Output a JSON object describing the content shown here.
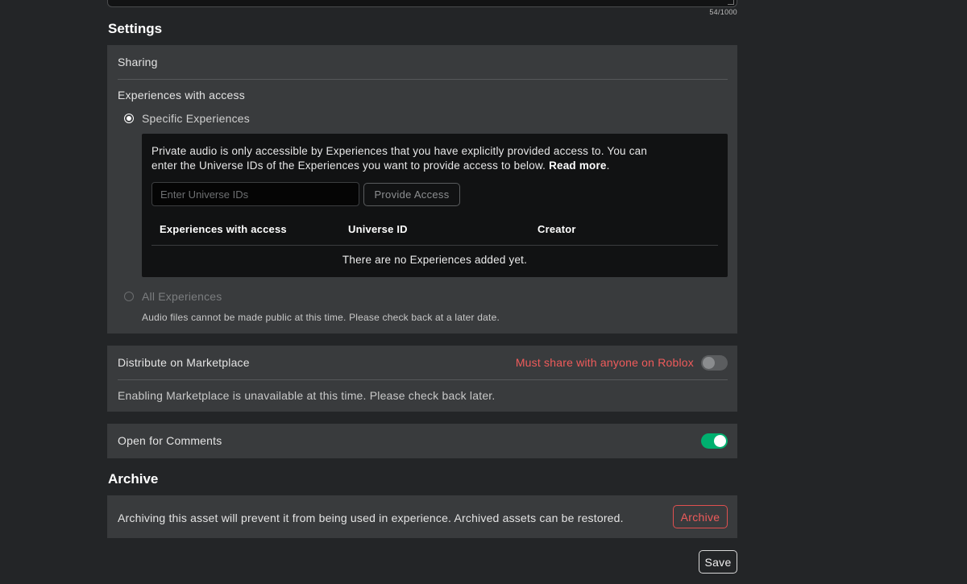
{
  "description_field": {
    "char_count": "54/1000"
  },
  "settings": {
    "title": "Settings",
    "sharing": {
      "label": "Sharing",
      "experiences_heading": "Experiences with access",
      "specific_option": {
        "label": "Specific Experiences",
        "selected": true,
        "info_text_line1": "Private audio is only accessible by Experiences that you have explicitly provided access to. You can",
        "info_text_line2": "enter the Universe IDs of the Experiences you want to provide access to below.",
        "read_more": "Read more",
        "info_text_end": ".",
        "input_placeholder": "Enter Universe IDs",
        "input_value": "",
        "provide_button": "Provide Access",
        "table": {
          "columns": [
            "Experiences with access",
            "Universe ID",
            "Creator"
          ],
          "rows": [],
          "empty_text": "There are no Experiences added yet."
        }
      },
      "all_option": {
        "label": "All Experiences",
        "selected": false,
        "disabled": true,
        "note": "Audio files cannot be made public at this time. Please check back at a later date."
      }
    },
    "marketplace": {
      "label": "Distribute on Marketplace",
      "warning": "Must share with anyone on Roblox",
      "enabled": false,
      "note": "Enabling Marketplace is unavailable at this time. Please check back later."
    },
    "comments": {
      "label": "Open for Comments",
      "enabled": true
    }
  },
  "archive": {
    "title": "Archive",
    "text": "Archiving this asset will prevent it from being used in experience. Archived assets can be restored.",
    "button": "Archive"
  },
  "save_button": "Save",
  "colors": {
    "background": "#232527",
    "panel": "#393b3d",
    "inner_panel": "#111213",
    "warning_red": "#ef5b5b",
    "toggle_on_green": "#00b06f"
  }
}
